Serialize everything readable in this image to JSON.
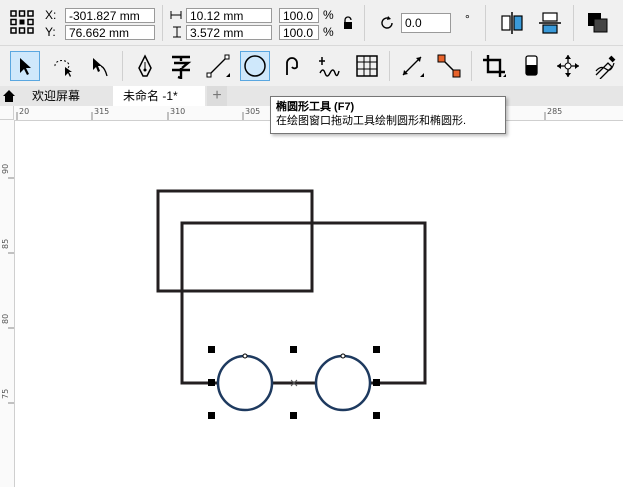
{
  "propbar": {
    "x_label": "X:",
    "y_label": "Y:",
    "x_value": "-301.827 mm",
    "y_value": "76.662 mm",
    "width_value": "10.12 mm",
    "height_value": "3.572 mm",
    "scale_x": "100.0",
    "scale_y": "100.0",
    "percent": "%",
    "rotation_value": "0.0",
    "degree_symbol": "°"
  },
  "tabs": {
    "welcome": "欢迎屏幕",
    "document": "未命名 -1*",
    "add": "+"
  },
  "tooltip": {
    "title": "椭圆形工具 (F7)",
    "description": "在绘图窗口拖动工具绘制圆形和椭圆形."
  },
  "ruler": {
    "h_labels": [
      "20",
      "315",
      "310",
      "305",
      "285"
    ],
    "v_labels": [
      "90",
      "85",
      "80",
      "75"
    ]
  },
  "colors": {
    "accent": "#5aa7e0",
    "toolbar_bg": "#f0f0f0",
    "shape_stroke": "#231f20",
    "circle_stroke": "#1e3a5f"
  },
  "icons": {
    "object_position": "grid-position-icon",
    "lock_ratio": "lock-icon",
    "rotate": "rotate-icon",
    "mirror_h": "mirror-horizontal-icon",
    "mirror_v": "mirror-vertical-icon",
    "arrange": "arrange-icon"
  }
}
